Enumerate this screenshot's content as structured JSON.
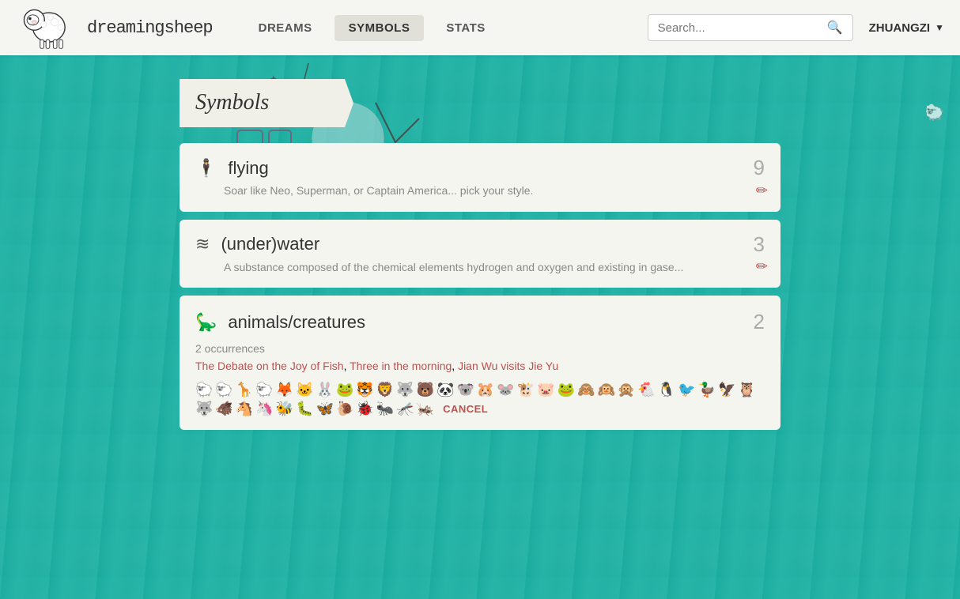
{
  "header": {
    "site_name": "dreamingsheep",
    "nav": {
      "dreams_label": "DREAMS",
      "symbols_label": "SYMBOLS",
      "stats_label": "STATS"
    },
    "search": {
      "placeholder": "Search...",
      "value": ""
    },
    "user": {
      "name": "ZHUANGZI",
      "chevron": "▼"
    }
  },
  "page": {
    "heading": "Symbols"
  },
  "symbols": [
    {
      "id": "flying",
      "icon": "🕴",
      "title": "flying",
      "count": "9",
      "description": "Soar like Neo, Superman, or Captain America... pick your style.",
      "edit_icon": "✏"
    },
    {
      "id": "underwater",
      "icon": "🌊",
      "title": "(under)water",
      "count": "3",
      "description": "A substance composed of the chemical elements hydrogen and oxygen and existing in gase...",
      "edit_icon": "✏"
    }
  ],
  "expanded_symbol": {
    "id": "animals-creatures",
    "icon": "🦕",
    "title": "animals/creatures",
    "count": "2",
    "occurrences_label": "2 occurrences",
    "dream_links": [
      "The Debate on the Joy of Fish",
      "Three in the morning",
      "Jian Wu visits Jie Yu"
    ],
    "emojis": [
      "🐑",
      "🐑",
      "🦒",
      "🐑",
      "🦊",
      "🐱",
      "🐰",
      "🐸",
      "🐯",
      "🦁",
      "🐺",
      "🐻",
      "🐼",
      "🐨",
      "🐹",
      "🐭",
      "🐮",
      "🐷",
      "🐸",
      "🙈",
      "🙉",
      "🙊",
      "🐔",
      "🐧",
      "🐦",
      "🦆",
      "🦅",
      "🦉",
      "🐺",
      "🐗",
      "🐴",
      "🦄",
      "🐝",
      "🐛",
      "🦋",
      "🐌",
      "🐞",
      "🐜",
      "🦟",
      "🦗"
    ],
    "cancel_label": "CANCEL"
  }
}
